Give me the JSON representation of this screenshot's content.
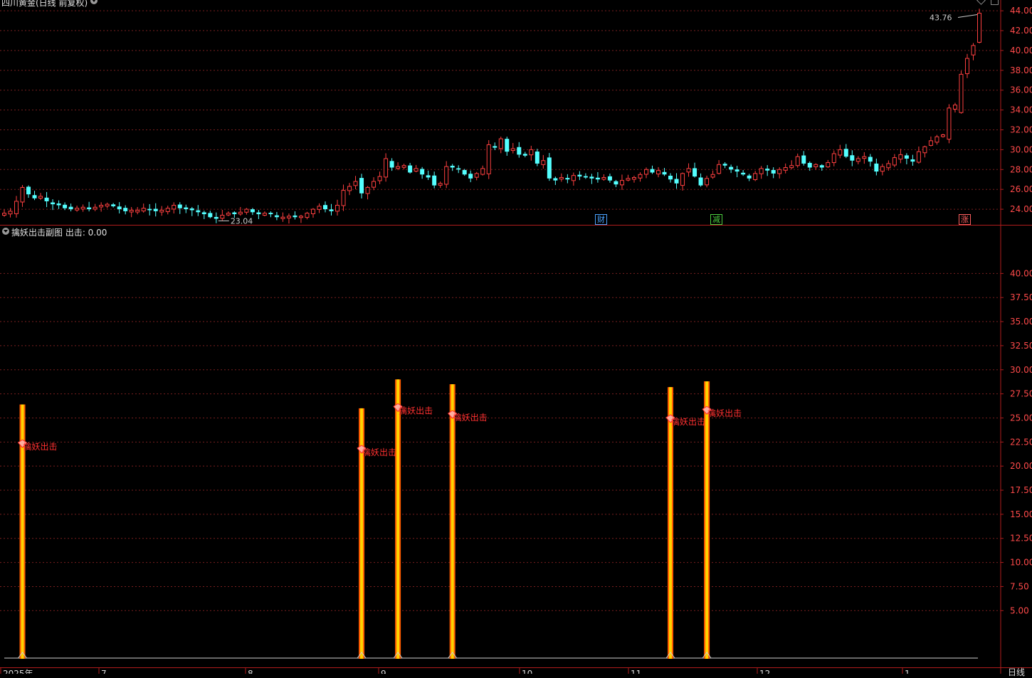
{
  "header": {
    "main_title": "四川黄金(日线 前复权)",
    "sub_title": "擒妖出击副图 出击: 0.00"
  },
  "period_label": "日线",
  "colors": {
    "up": "#ff4040",
    "down": "#54ffff",
    "grid": "#7a1f1f",
    "axis": "#b01c1c",
    "bar_fill": "#ffd200",
    "bar_edge": "#ff5a00",
    "signal_text": "#ff3030"
  },
  "events": [
    {
      "label": "财",
      "color": "#4aa3ff"
    },
    {
      "label": "减",
      "color": "#4cd040"
    },
    {
      "label": "涨",
      "color": "#ff6060"
    }
  ],
  "chart_data": [
    {
      "type": "candlestick",
      "ylim": [
        22.5,
        44.8
      ],
      "yticks": [
        "44.00",
        "42.00",
        "40.00",
        "38.00",
        "36.00",
        "34.00",
        "32.00",
        "30.00",
        "28.00",
        "26.00",
        "24.00"
      ],
      "high_label": "43.76",
      "low_label": "23.04",
      "x_ticks": [
        "2025年",
        "7",
        "8",
        "9",
        "10",
        "11",
        "12",
        "1"
      ],
      "close": [
        23.6,
        23.8,
        24.8,
        26.2,
        25.5,
        25.1,
        25.3,
        24.8,
        24.5,
        24.4,
        24.1,
        24.0,
        24.1,
        24.2,
        24.0,
        24.2,
        24.4,
        24.5,
        24.3,
        24.0,
        23.8,
        23.9,
        23.9,
        24.1,
        23.9,
        23.8,
        23.9,
        24.1,
        24.4,
        24.1,
        24.0,
        23.9,
        23.7,
        23.5,
        23.2,
        23.04,
        23.4,
        23.6,
        23.5,
        23.7,
        24.0,
        23.7,
        23.5,
        23.6,
        23.5,
        23.2,
        23.2,
        23.3,
        23.2,
        23.3,
        23.6,
        24.0,
        24.3,
        24.0,
        23.8,
        24.4,
        25.9,
        26.3,
        26.8,
        25.6,
        26.2,
        26.8,
        27.3,
        29.1,
        28.2,
        28.3,
        28.4,
        27.7,
        28.1,
        27.5,
        27.2,
        26.4,
        26.6,
        28.3,
        28.2,
        28.0,
        27.5,
        27.1,
        27.6,
        28.1,
        30.5,
        30.2,
        31.1,
        29.8,
        30.1,
        29.5,
        29.4,
        30.0,
        28.6,
        28.9,
        27.1,
        26.9,
        27.2,
        27.0,
        27.4,
        27.3,
        27.2,
        27.1,
        27.0,
        27.2,
        26.9,
        26.5,
        26.9,
        27.1,
        27.2,
        27.5,
        28.0,
        27.7,
        27.9,
        27.5,
        27.0,
        26.6,
        27.6,
        28.1,
        27.3,
        26.4,
        27.1,
        27.5,
        28.5,
        28.4,
        28.0,
        27.8,
        27.5,
        27.1,
        27.6,
        28.1,
        27.9,
        27.6,
        28.0,
        28.2,
        28.4,
        29.3,
        28.6,
        28.2,
        28.5,
        28.2,
        28.7,
        29.6,
        30.0,
        29.3,
        28.9,
        29.1,
        29.3,
        28.8,
        27.8,
        28.3,
        28.6,
        29.2,
        29.5,
        29.1,
        28.8,
        29.8,
        30.3,
        30.9,
        31.3,
        31.5,
        34.2,
        34.5,
        37.6,
        39.2,
        40.5,
        43.76
      ],
      "signal_panel": {
        "ylim": [
          0,
          44.9
        ],
        "yticks": [
          "40.00",
          "37.50",
          "35.00",
          "32.50",
          "30.00",
          "27.50",
          "25.00",
          "22.50",
          "20.00",
          "17.50",
          "15.00",
          "12.50",
          "10.00",
          "7.50",
          "5.00"
        ],
        "signal_label": "擒妖出击",
        "signal_indices": [
          3,
          59,
          65,
          74,
          110,
          116
        ],
        "signal_values": [
          26.4,
          26.0,
          29.0,
          28.5,
          28.2,
          28.8
        ]
      }
    }
  ]
}
